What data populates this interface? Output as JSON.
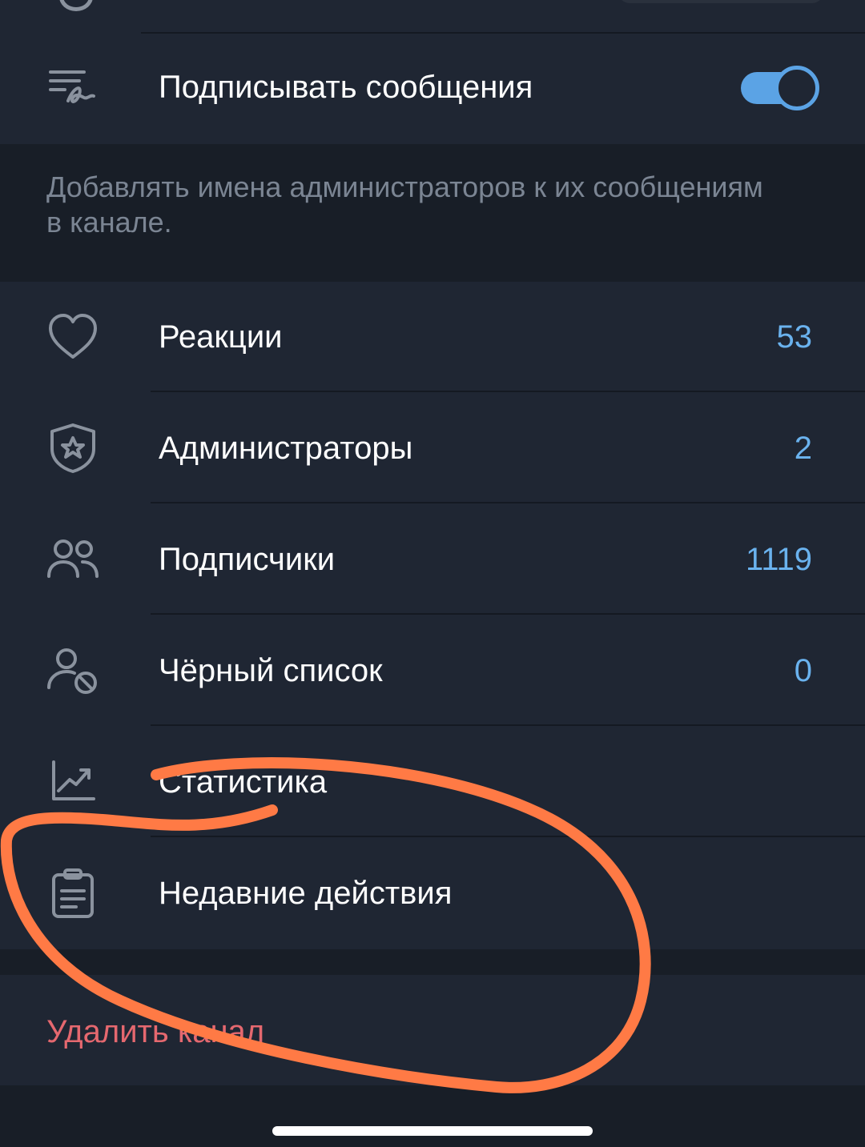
{
  "sign_messages": {
    "label": "Подписывать сообщения",
    "enabled": true,
    "hint": "Добавлять имена администраторов к их сообщениям в канале."
  },
  "menu": {
    "reactions": {
      "label": "Реакции",
      "value": "53",
      "icon": "heart-icon"
    },
    "administrators": {
      "label": "Администраторы",
      "value": "2",
      "icon": "shield-star-icon"
    },
    "subscribers": {
      "label": "Подписчики",
      "value": "1119",
      "icon": "users-icon"
    },
    "blacklist": {
      "label": "Чёрный список",
      "value": "0",
      "icon": "user-blocked-icon"
    },
    "statistics": {
      "label": "Статистика",
      "icon": "chart-icon"
    },
    "recent_actions": {
      "label": "Недавние действия",
      "icon": "clipboard-icon"
    }
  },
  "delete_channel": {
    "label": "Удалить канал"
  },
  "colors": {
    "background": "#181e27",
    "section": "#1f2633",
    "accent": "#5ba3e5",
    "value": "#6ab2ee",
    "danger": "#e5686f",
    "annotation": "#ff7a45"
  }
}
